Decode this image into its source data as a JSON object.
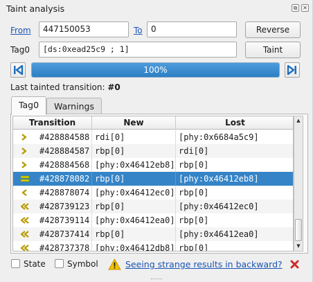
{
  "window": {
    "title": "Taint analysis",
    "float_icon": "float-icon",
    "close_icon": "close-icon"
  },
  "range": {
    "from_label": "From",
    "from_value": "447150053",
    "to_label": "To",
    "to_value": "0",
    "reverse_label": "Reverse"
  },
  "tag": {
    "label": "Tag0",
    "value": "[ds:0xead25c9 ; 1]",
    "taint_label": "Taint"
  },
  "progress": {
    "value": 1.0,
    "text": "100%",
    "first_icon": "skip-to-first-icon",
    "last_icon": "skip-to-last-icon"
  },
  "last_tainted": {
    "label": "Last tainted transition:",
    "value": "#0"
  },
  "tabs": [
    {
      "label": "Tag0",
      "active": true
    },
    {
      "label": "Warnings",
      "active": false
    }
  ],
  "table": {
    "columns": [
      "Transition",
      "New",
      "Lost"
    ],
    "rows": [
      {
        "icon": "single-right",
        "transition": "#428884588",
        "new": "rdi[0]",
        "lost": "[phy:0x6684a5c9]",
        "selected": false
      },
      {
        "icon": "single-right",
        "transition": "#428884587",
        "new": "rbp[0]",
        "lost": "rdi[0]",
        "selected": false
      },
      {
        "icon": "single-right",
        "transition": "#428884568",
        "new": "[phy:0x46412eb8]",
        "lost": "rbp[0]",
        "selected": false
      },
      {
        "icon": "equal",
        "transition": "#428878082",
        "new": "rbp[0]",
        "lost": "[phy:0x46412eb8]",
        "selected": true
      },
      {
        "icon": "single-left",
        "transition": "#428878074",
        "new": "[phy:0x46412ec0]",
        "lost": "rbp[0]",
        "selected": false
      },
      {
        "icon": "double-left",
        "transition": "#428739123",
        "new": "rbp[0]",
        "lost": "[phy:0x46412ec0]",
        "selected": false
      },
      {
        "icon": "double-left",
        "transition": "#428739114",
        "new": "[phy:0x46412ea0]",
        "lost": "rbp[0]",
        "selected": false
      },
      {
        "icon": "double-left",
        "transition": "#428737414",
        "new": "rbp[0]",
        "lost": "[phy:0x46412ea0]",
        "selected": false
      },
      {
        "icon": "double-left",
        "transition": "#428737378",
        "new": "[phy:0x46412db8]",
        "lost": "rbp[0]",
        "selected": false
      }
    ],
    "scroll_position": 0.9
  },
  "footer": {
    "state_label": "State",
    "state_checked": false,
    "symbol_label": "Symbol",
    "symbol_checked": false,
    "warning_icon": "warning-icon",
    "warning_link": "Seeing strange results in backward?",
    "dismiss_icon": "dismiss-icon"
  },
  "colors": {
    "accent": "#3584c7",
    "link": "#1a55b5",
    "direction_arrow": "#b79b00",
    "equal_icon": "#d8d000",
    "warning": "#f2c200",
    "dismiss": "#d12b2b"
  }
}
